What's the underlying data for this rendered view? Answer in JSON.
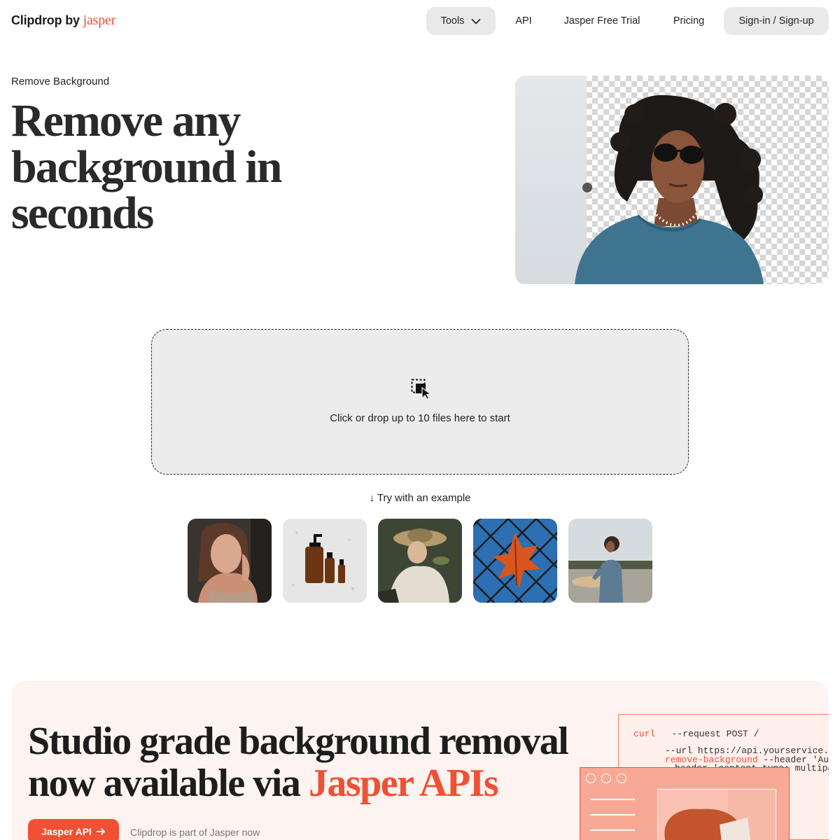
{
  "nav": {
    "logo_main": "Clipdrop",
    "logo_by": "by",
    "logo_brand": "jasper",
    "tools": "Tools",
    "api": "API",
    "trial": "Jasper Free Trial",
    "pricing": "Pricing",
    "sign": "Sign-in / Sign-up"
  },
  "hero": {
    "eyebrow": "Remove Background",
    "title_line1": "Remove any",
    "title_line2": "background in",
    "title_line3": "seconds"
  },
  "dropzone": {
    "text": "Click or drop up to 10 files here to start"
  },
  "examples": {
    "label": "↓ Try with an example"
  },
  "banner": {
    "title_part1": "Studio grade background removal",
    "title_part2": "now available via ",
    "title_accent": "Jasper APIs",
    "button": "Jasper API",
    "note": "Clipdrop is part of Jasper now",
    "code": {
      "l1_kw": "curl",
      "l1_rest": "--request  POST  /",
      "l2": "--url https://api.yourservice.co",
      "l3_kw": "remove-background",
      "l3_rest": " --header 'Auth",
      "l4": "header 'content-type: multipa"
    }
  },
  "colors": {
    "accent": "#f05033",
    "banner_bg": "#fdf3f0",
    "dropzone_bg": "#ececec"
  }
}
